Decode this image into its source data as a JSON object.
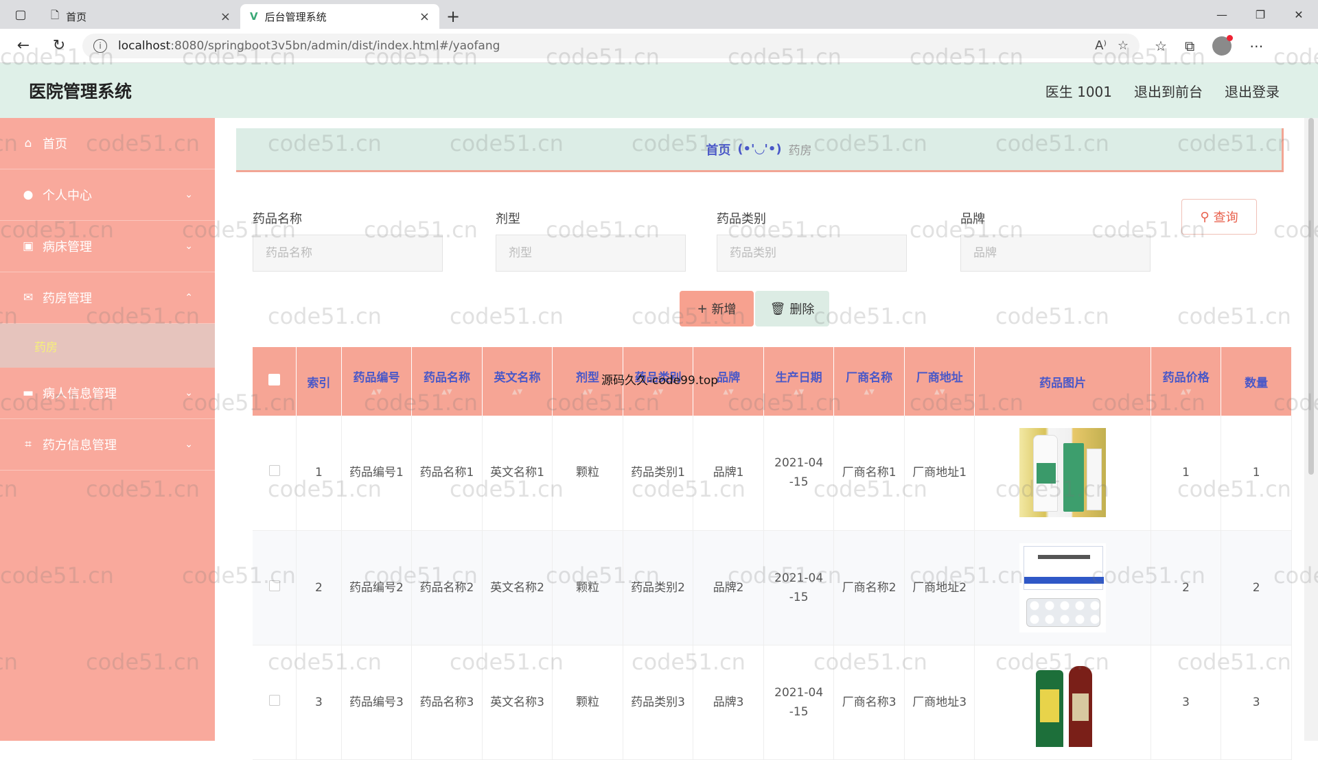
{
  "browser": {
    "tabs": [
      {
        "title": "首页"
      },
      {
        "title": "后台管理系统"
      }
    ],
    "url_host": "localhost",
    "url_rest": ":8080/springboot3v5bn/admin/dist/index.html#/yaofang"
  },
  "header": {
    "title": "医院管理系统",
    "user": "医生 1001",
    "front_link": "退出到前台",
    "logout": "退出登录"
  },
  "sidebar": {
    "items": [
      {
        "label": "首页",
        "icon": "home-icon"
      },
      {
        "label": "个人中心",
        "icon": "user-icon"
      },
      {
        "label": "病床管理",
        "icon": "bed-icon"
      },
      {
        "label": "药房管理",
        "icon": "mail-icon"
      },
      {
        "label": "病人信息管理",
        "icon": "monitor-icon"
      },
      {
        "label": "药方信息管理",
        "icon": "crop-icon"
      }
    ],
    "sub_active": "药房"
  },
  "breadcrumb": {
    "home": "首页",
    "face": "(•'◡'•)",
    "current": "药房"
  },
  "search": {
    "fields": [
      {
        "label": "药品名称",
        "placeholder": "药品名称"
      },
      {
        "label": "剂型",
        "placeholder": "剂型"
      },
      {
        "label": "药品类别",
        "placeholder": "药品类别"
      },
      {
        "label": "品牌",
        "placeholder": "品牌"
      }
    ],
    "query_label": "查询"
  },
  "actions": {
    "add_label": "新增",
    "delete_label": "删除"
  },
  "table": {
    "headers": [
      "索引",
      "药品编号",
      "药品名称",
      "英文名称",
      "剂型",
      "药品类别",
      "品牌",
      "生产日期",
      "厂商名称",
      "厂商地址",
      "药品图片",
      "药品价格",
      "数量"
    ],
    "rows": [
      {
        "idx": "1",
        "code": "药品编号1",
        "name": "药品名称1",
        "en": "英文名称1",
        "form": "颗粒",
        "cat": "药品类别1",
        "brand": "品牌1",
        "date": "2021-04-15",
        "maker": "厂商名称1",
        "addr": "厂商地址1",
        "price": "1",
        "qty": "1"
      },
      {
        "idx": "2",
        "code": "药品编号2",
        "name": "药品名称2",
        "en": "英文名称2",
        "form": "颗粒",
        "cat": "药品类别2",
        "brand": "品牌2",
        "date": "2021-04-15",
        "maker": "厂商名称2",
        "addr": "厂商地址2",
        "price": "2",
        "qty": "2"
      },
      {
        "idx": "3",
        "code": "药品编号3",
        "name": "药品名称3",
        "en": "英文名称3",
        "form": "颗粒",
        "cat": "药品类别3",
        "brand": "品牌3",
        "date": "2021-04-15",
        "maker": "厂商名称3",
        "addr": "厂商地址3",
        "price": "3",
        "qty": "3"
      }
    ]
  },
  "overlay_text": "源码久久-code99.top",
  "watermark": "code51.cn"
}
